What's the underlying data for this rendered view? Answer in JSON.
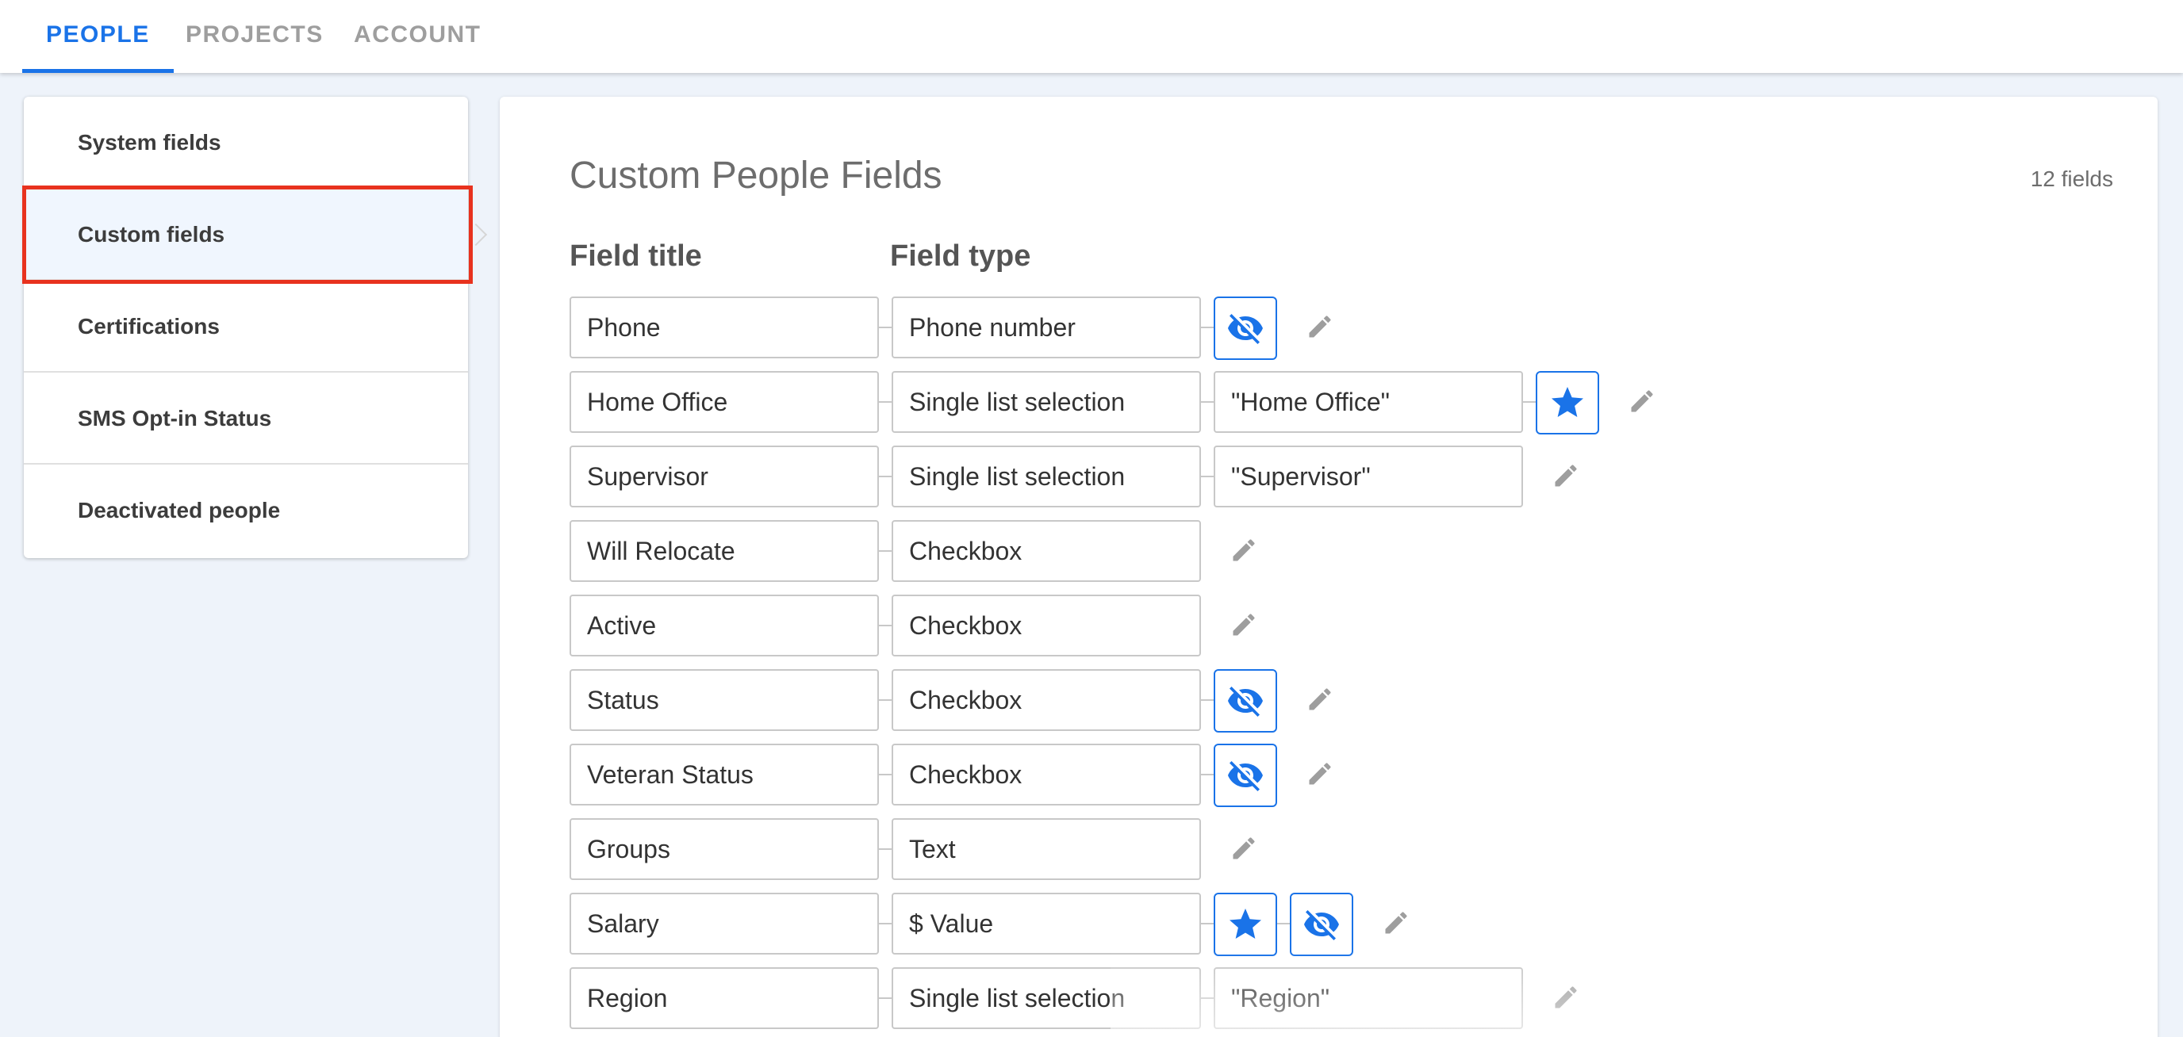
{
  "tabs": [
    {
      "label": "PEOPLE",
      "active": true
    },
    {
      "label": "PROJECTS",
      "active": false
    },
    {
      "label": "ACCOUNT",
      "active": false
    }
  ],
  "sidebar": {
    "items": [
      {
        "label": "System fields"
      },
      {
        "label": "Custom fields",
        "selected": true
      },
      {
        "label": "Certifications"
      },
      {
        "label": "SMS Opt-in Status"
      },
      {
        "label": "Deactivated people"
      }
    ]
  },
  "main": {
    "title": "Custom People Fields",
    "count": "12 fields",
    "col_title": "Field title",
    "col_type": "Field type"
  },
  "fields": [
    {
      "title": "Phone",
      "type": "Phone number",
      "value": "",
      "icons": [
        "eye-off-icon"
      ]
    },
    {
      "title": "Home Office",
      "type": "Single list selection",
      "value": "\"Home Office\"",
      "icons": [
        "star-icon"
      ]
    },
    {
      "title": "Supervisor",
      "type": "Single list selection",
      "value": "\"Supervisor\"",
      "icons": []
    },
    {
      "title": "Will Relocate",
      "type": "Checkbox",
      "value": "",
      "icons": []
    },
    {
      "title": "Active",
      "type": "Checkbox",
      "value": "",
      "icons": []
    },
    {
      "title": "Status",
      "type": "Checkbox",
      "value": "",
      "icons": [
        "eye-off-icon"
      ]
    },
    {
      "title": "Veteran Status",
      "type": "Checkbox",
      "value": "",
      "icons": [
        "eye-off-icon"
      ]
    },
    {
      "title": "Groups",
      "type": "Text",
      "value": "",
      "icons": []
    },
    {
      "title": "Salary",
      "type": "$ Value",
      "value": "",
      "icons": [
        "star-icon",
        "eye-off-icon"
      ]
    },
    {
      "title": "Region",
      "type": "Single list selection",
      "value": "\"Region\"",
      "icons": []
    }
  ],
  "colors": {
    "accent": "#1a73e8",
    "highlight": "#e8321e",
    "border": "#c8c8c8",
    "pencil": "#9e9e9e"
  }
}
